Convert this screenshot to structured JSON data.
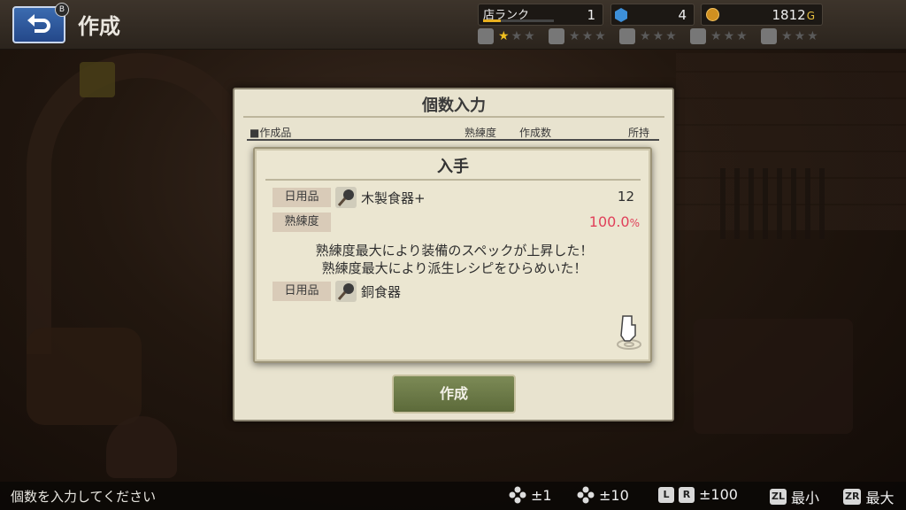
{
  "header": {
    "back_badge": "B",
    "title": "作成",
    "shop_rank": {
      "label": "店ランク",
      "value": "1",
      "progress": 0.25
    },
    "crystals": {
      "value": "4"
    },
    "gold": {
      "value": "1812",
      "unit": "G"
    },
    "skills": [
      {
        "icon": "pickaxe-icon",
        "stars": 1,
        "max": 3
      },
      {
        "icon": "pot-icon",
        "stars": 0,
        "max": 3
      },
      {
        "icon": "hammer-icon",
        "stars": 0,
        "max": 3
      },
      {
        "icon": "ladder-icon",
        "stars": 0,
        "max": 3
      },
      {
        "icon": "cloth-icon",
        "stars": 0,
        "max": 3
      }
    ]
  },
  "panel": {
    "title": "個数入力",
    "headers": {
      "item": "■作成品",
      "mastery": "熟練度",
      "count": "作成数",
      "owned": "所持"
    },
    "create_button": "作成"
  },
  "dialog": {
    "title": "入手",
    "item_tag": "日用品",
    "item_name": "木製食器+",
    "item_count": "12",
    "mastery_tag": "熟練度",
    "mastery_value": "100.0",
    "mastery_unit": "%",
    "message_1": "熟練度最大により装備のスペックが上昇した！",
    "message_2": "熟練度最大により派生レシピをひらめいた！",
    "derived_tag": "日用品",
    "derived_name": "銅食器"
  },
  "footer": {
    "hint": "個数を入力してください",
    "controls": [
      {
        "key": "dpad-icon",
        "label": "±1"
      },
      {
        "key": "stick-icon",
        "label": "±10"
      },
      {
        "keys": [
          "L",
          "R"
        ],
        "label": "±100"
      },
      {
        "keys": [
          "ZL"
        ],
        "label": "最小"
      },
      {
        "keys": [
          "ZR"
        ],
        "label": "最大"
      }
    ]
  },
  "colors": {
    "accent_red": "#e0405a",
    "button_green": "#6a7848",
    "star_gold": "#f0c020"
  }
}
